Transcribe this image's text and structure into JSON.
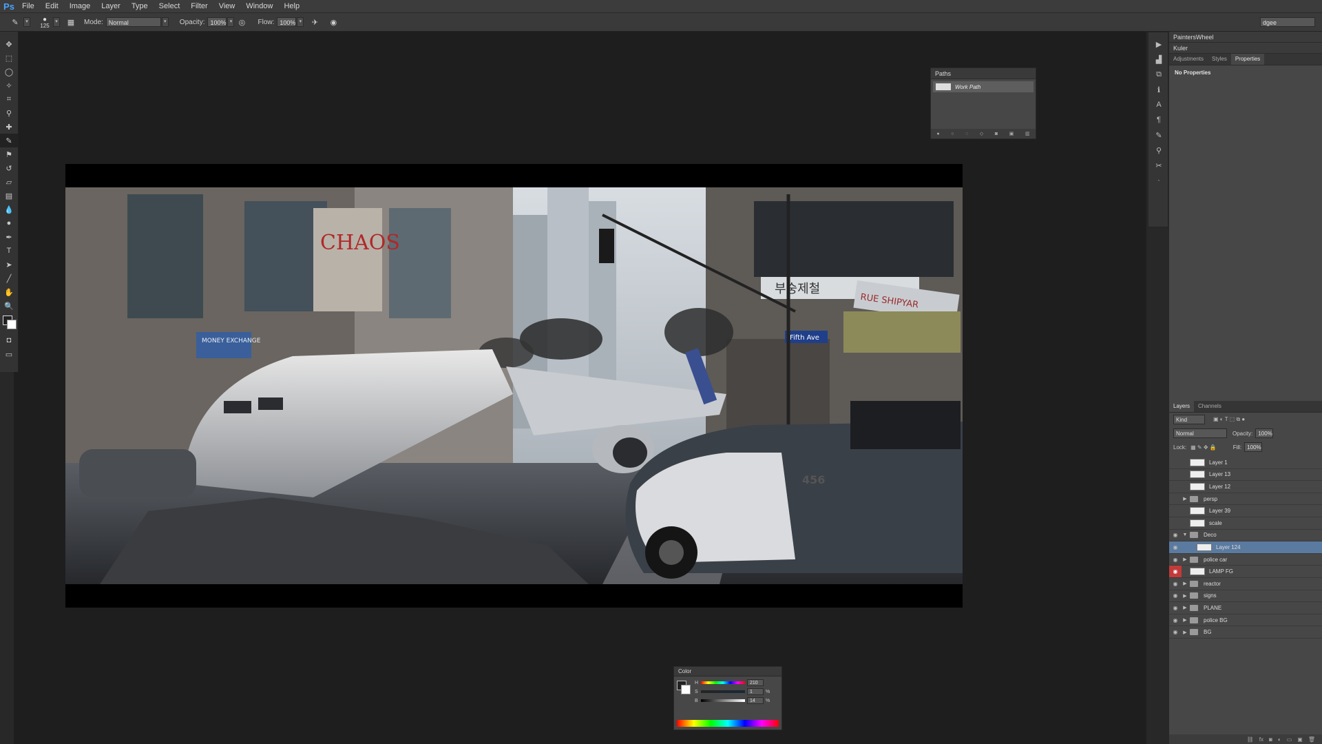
{
  "app": {
    "logo": "Ps"
  },
  "menu": [
    "File",
    "Edit",
    "Image",
    "Layer",
    "Type",
    "Select",
    "Filter",
    "View",
    "Window",
    "Help"
  ],
  "options": {
    "brush_size": "125",
    "mode_label": "Mode:",
    "mode_value": "Normal",
    "opacity_label": "Opacity:",
    "opacity_value": "100%",
    "flow_label": "Flow:",
    "flow_value": "100%",
    "workspace": "dgee"
  },
  "paths_panel": {
    "title": "Paths",
    "item": "Work Path"
  },
  "right_top": {
    "row1": "PaintersWheel",
    "row2": "Kuler",
    "tabs": [
      "Adjustments",
      "Styles",
      "Properties"
    ],
    "active_tab": "Properties",
    "properties_text": "No Properties"
  },
  "layers_panel": {
    "tabs": [
      "Layers",
      "Channels"
    ],
    "filter": "Kind",
    "blend_mode": "Normal",
    "opacity_label": "Opacity:",
    "opacity_value": "100%",
    "lock_label": "Lock:",
    "fill_label": "Fill:",
    "fill_value": "100%",
    "layers": [
      {
        "name": "Layer 1",
        "type": "layer",
        "visible": false
      },
      {
        "name": "Layer 13",
        "type": "layer",
        "visible": false
      },
      {
        "name": "Layer 12",
        "type": "layer",
        "visible": false
      },
      {
        "name": "persp",
        "type": "group",
        "visible": false
      },
      {
        "name": "Layer 39",
        "type": "layer",
        "visible": false
      },
      {
        "name": "scale",
        "type": "layer",
        "visible": false
      },
      {
        "name": "Deco",
        "type": "group-open",
        "visible": true
      },
      {
        "name": "Layer 124",
        "type": "layer",
        "visible": true,
        "selected": true
      },
      {
        "name": "police car",
        "type": "group",
        "visible": true
      },
      {
        "name": "LAMP FG",
        "type": "layer",
        "visible": true,
        "red_eye": true
      },
      {
        "name": "reactor",
        "type": "group",
        "visible": true
      },
      {
        "name": "signs",
        "type": "group",
        "visible": true
      },
      {
        "name": "PLANE",
        "type": "group",
        "visible": true
      },
      {
        "name": "police BG",
        "type": "group",
        "visible": true
      },
      {
        "name": "BG",
        "type": "group",
        "visible": true
      }
    ]
  },
  "color_panel": {
    "title": "Color",
    "h_label": "H",
    "h_value": "210",
    "s_label": "S",
    "s_value": "1",
    "b_label": "B",
    "b_value": "14",
    "pct": "%"
  },
  "artwork_text": {
    "graffiti": "CHAOS",
    "sign_money": "MONEY EXCHANGE",
    "sign_korean": "부숭제철",
    "sign_shipyard": "RUE SHIPYAR",
    "street_sign": "Fifth Ave",
    "car_number": "456"
  },
  "colors": {
    "accent": "#4aa3ff",
    "selected_layer": "#5a7aa0",
    "red_eye": "#c23a3a"
  }
}
